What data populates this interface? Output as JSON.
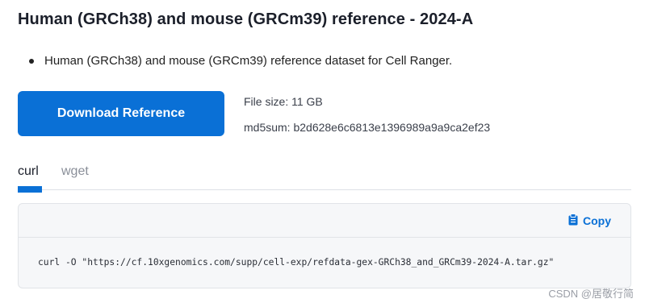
{
  "title": "Human (GRCh38) and mouse (GRCm39) reference - 2024-A",
  "bullets": [
    "Human (GRCh38) and mouse (GRCm39) reference dataset for Cell Ranger."
  ],
  "download_button": "Download Reference",
  "file_size": "File size: 11 GB",
  "md5sum": "md5sum: b2d628e6c6813e1396989a9a9ca2ef23",
  "tabs": [
    {
      "label": "curl",
      "active": true
    },
    {
      "label": "wget",
      "active": false
    }
  ],
  "code": {
    "copy_label": "Copy",
    "command": "curl -O \"https://cf.10xgenomics.com/supp/cell-exp/refdata-gex-GRCh38_and_GRCm39-2024-A.tar.gz\""
  },
  "watermark": "CSDN @居敬行简",
  "colors": {
    "accent": "#0a70d6",
    "panel_bg": "#f6f7f9"
  },
  "icons": {
    "copy": "clipboard-icon"
  }
}
